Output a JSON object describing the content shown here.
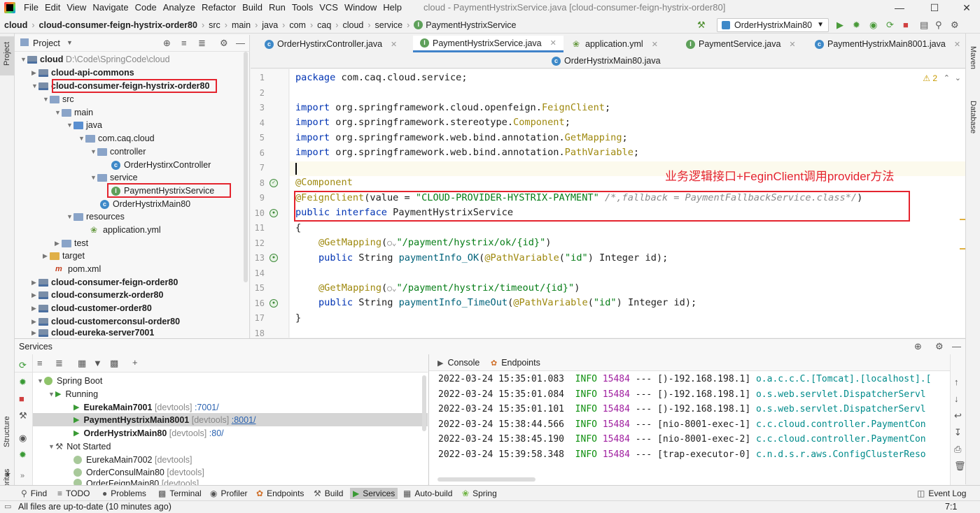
{
  "titlebar": {
    "menus": [
      "File",
      "Edit",
      "View",
      "Navigate",
      "Code",
      "Analyze",
      "Refactor",
      "Build",
      "Run",
      "Tools",
      "VCS",
      "Window",
      "Help"
    ],
    "title": "cloud - PaymentHystrixService.java [cloud-consumer-feign-hystrix-order80]"
  },
  "navbar": {
    "crumbs": [
      "cloud",
      "cloud-consumer-feign-hystrix-order80",
      "src",
      "main",
      "java",
      "com",
      "caq",
      "cloud",
      "service",
      "PaymentHystrixService"
    ],
    "run_config": "OrderHystrixMain80"
  },
  "sidestrips": {
    "left_top": "Project",
    "left_mid": "Structure",
    "left_bottom": "Favorites",
    "right_top": "Maven",
    "right_mid": "Database"
  },
  "project": {
    "header": "Project",
    "tree": [
      {
        "label": "cloud",
        "extra": "D:\\Code\\SpringCode\\cloud"
      },
      {
        "label": "cloud-api-commons"
      },
      {
        "label": "cloud-consumer-feign-hystrix-order80"
      },
      {
        "label": "src"
      },
      {
        "label": "main"
      },
      {
        "label": "java"
      },
      {
        "label": "com.caq.cloud"
      },
      {
        "label": "controller"
      },
      {
        "label": "OrderHystirxController"
      },
      {
        "label": "service"
      },
      {
        "label": "PaymentHystrixService"
      },
      {
        "label": "OrderHystrixMain80"
      },
      {
        "label": "resources"
      },
      {
        "label": "application.yml"
      },
      {
        "label": "test"
      },
      {
        "label": "target"
      },
      {
        "label": "pom.xml"
      },
      {
        "label": "cloud-consumer-feign-order80"
      },
      {
        "label": "cloud-consumerzk-order80"
      },
      {
        "label": "cloud-customer-order80"
      },
      {
        "label": "cloud-customerconsul-order80"
      },
      {
        "label": "cloud-eureka-server7001"
      }
    ]
  },
  "editor": {
    "tabs": [
      "OrderHystirxController.java",
      "PaymentHystrixService.java",
      "application.yml",
      "PaymentService.java",
      "PaymentHystrixMain8001.java",
      "OrderHystrixMain80.java"
    ],
    "warnings": "2",
    "annotation_note": "业务逻辑接口+FeginClient调用provider方法",
    "line_numbers": [
      "1",
      "2",
      "3",
      "4",
      "5",
      "6",
      "7",
      "8",
      "9",
      "10",
      "11",
      "12",
      "13",
      "14",
      "15",
      "16",
      "17",
      "18"
    ],
    "code": {
      "l1a": "package",
      "l1b": " com.caq.cloud.service;",
      "l3a": "import",
      "l3b": " org.springframework.cloud.openfeign.",
      "l3c": "FeignClient",
      "l3d": ";",
      "l4a": "import",
      "l4b": " org.springframework.stereotype.",
      "l4c": "Component",
      "l4d": ";",
      "l5a": "import",
      "l5b": " org.springframework.web.bind.annotation.",
      "l5c": "GetMapping",
      "l5d": ";",
      "l6a": "import",
      "l6b": " org.springframework.web.bind.annotation.",
      "l6c": "PathVariable",
      "l6d": ";",
      "l8": "@Component",
      "l9a": "@FeignClient",
      "l9b": "(value = ",
      "l9c": "\"CLOUD-PROVIDER-HYSTRIX-PAYMENT\"",
      "l9d": " /*,fallback = PaymentFallbackService.class*/",
      "l9e": ")",
      "l10a": "public interface",
      "l10b": " PaymentHystrixService",
      "l11": "{",
      "l12a": "@GetMapping",
      "l12b": "(",
      "l12c": "\"/payment/hystrix/ok/{id}\"",
      "l12d": ")",
      "l13a": "public",
      "l13b": " String ",
      "l13c": "paymentInfo_OK",
      "l13d": "(",
      "l13e": "@PathVariable",
      "l13f": "(",
      "l13g": "\"id\"",
      "l13h": ") Integer id);",
      "l15a": "@GetMapping",
      "l15b": "(",
      "l15c": "\"/payment/hystrix/timeout/{id}\"",
      "l15d": ")",
      "l16a": "public",
      "l16b": " String ",
      "l16c": "paymentInfo_TimeOut",
      "l16d": "(",
      "l16e": "@PathVariable",
      "l16f": "(",
      "l16g": "\"id\"",
      "l16h": ") Integer id);",
      "l17": "}"
    }
  },
  "services": {
    "title": "Services",
    "tree": {
      "spring_boot": "Spring Boot",
      "running": "Running",
      "r1": {
        "name": "EurekaMain7001",
        "tag": "[devtools]",
        "port": ":7001/"
      },
      "r2": {
        "name": "PaymentHystrixMain8001",
        "tag": "[devtools]",
        "port": ":8001/"
      },
      "r3": {
        "name": "OrderHystrixMain80",
        "tag": "[devtools]",
        "port": ":80/"
      },
      "not_started": "Not Started",
      "n1": {
        "name": "EurekaMain7002",
        "tag": "[devtools]"
      },
      "n2": {
        "name": "OrderConsulMain80",
        "tag": "[devtools]"
      },
      "n3": {
        "name": "OrderFeignMain80",
        "tag": "[devtools]"
      }
    },
    "console_tabs": [
      "Console",
      "Endpoints"
    ],
    "log": [
      {
        "ts": "2022-03-24 15:35:01.083",
        "level": "INFO",
        "pid": "15484",
        "sep": "---",
        "thread": "[)-192.168.198.1]",
        "logger": "o.a.c.c.C.[Tomcat].[localhost].["
      },
      {
        "ts": "2022-03-24 15:35:01.084",
        "level": "INFO",
        "pid": "15484",
        "sep": "---",
        "thread": "[)-192.168.198.1]",
        "logger": "o.s.web.servlet.DispatcherServl"
      },
      {
        "ts": "2022-03-24 15:35:01.101",
        "level": "INFO",
        "pid": "15484",
        "sep": "---",
        "thread": "[)-192.168.198.1]",
        "logger": "o.s.web.servlet.DispatcherServl"
      },
      {
        "ts": "2022-03-24 15:38:44.566",
        "level": "INFO",
        "pid": "15484",
        "sep": "---",
        "thread": "[nio-8001-exec-1]",
        "logger": "c.c.cloud.controller.PaymentCon"
      },
      {
        "ts": "2022-03-24 15:38:45.190",
        "level": "INFO",
        "pid": "15484",
        "sep": "---",
        "thread": "[nio-8001-exec-2]",
        "logger": "c.c.cloud.controller.PaymentCon"
      },
      {
        "ts": "2022-03-24 15:39:58.348",
        "level": "INFO",
        "pid": "15484",
        "sep": "---",
        "thread": "[trap-executor-0]",
        "logger": "c.n.d.s.r.aws.ConfigClusterReso"
      }
    ]
  },
  "bottom_tabs": [
    "Find",
    "TODO",
    "Problems",
    "Terminal",
    "Profiler",
    "Endpoints",
    "Build",
    "Services",
    "Auto-build",
    "Spring"
  ],
  "event_log": "Event Log",
  "status": {
    "message": "All files are up-to-date (10 minutes ago)",
    "position": "7:1"
  },
  "colors": {
    "accent": "#4083c9",
    "highlight": "#e4242e",
    "annotation_text": "#e4242e"
  }
}
